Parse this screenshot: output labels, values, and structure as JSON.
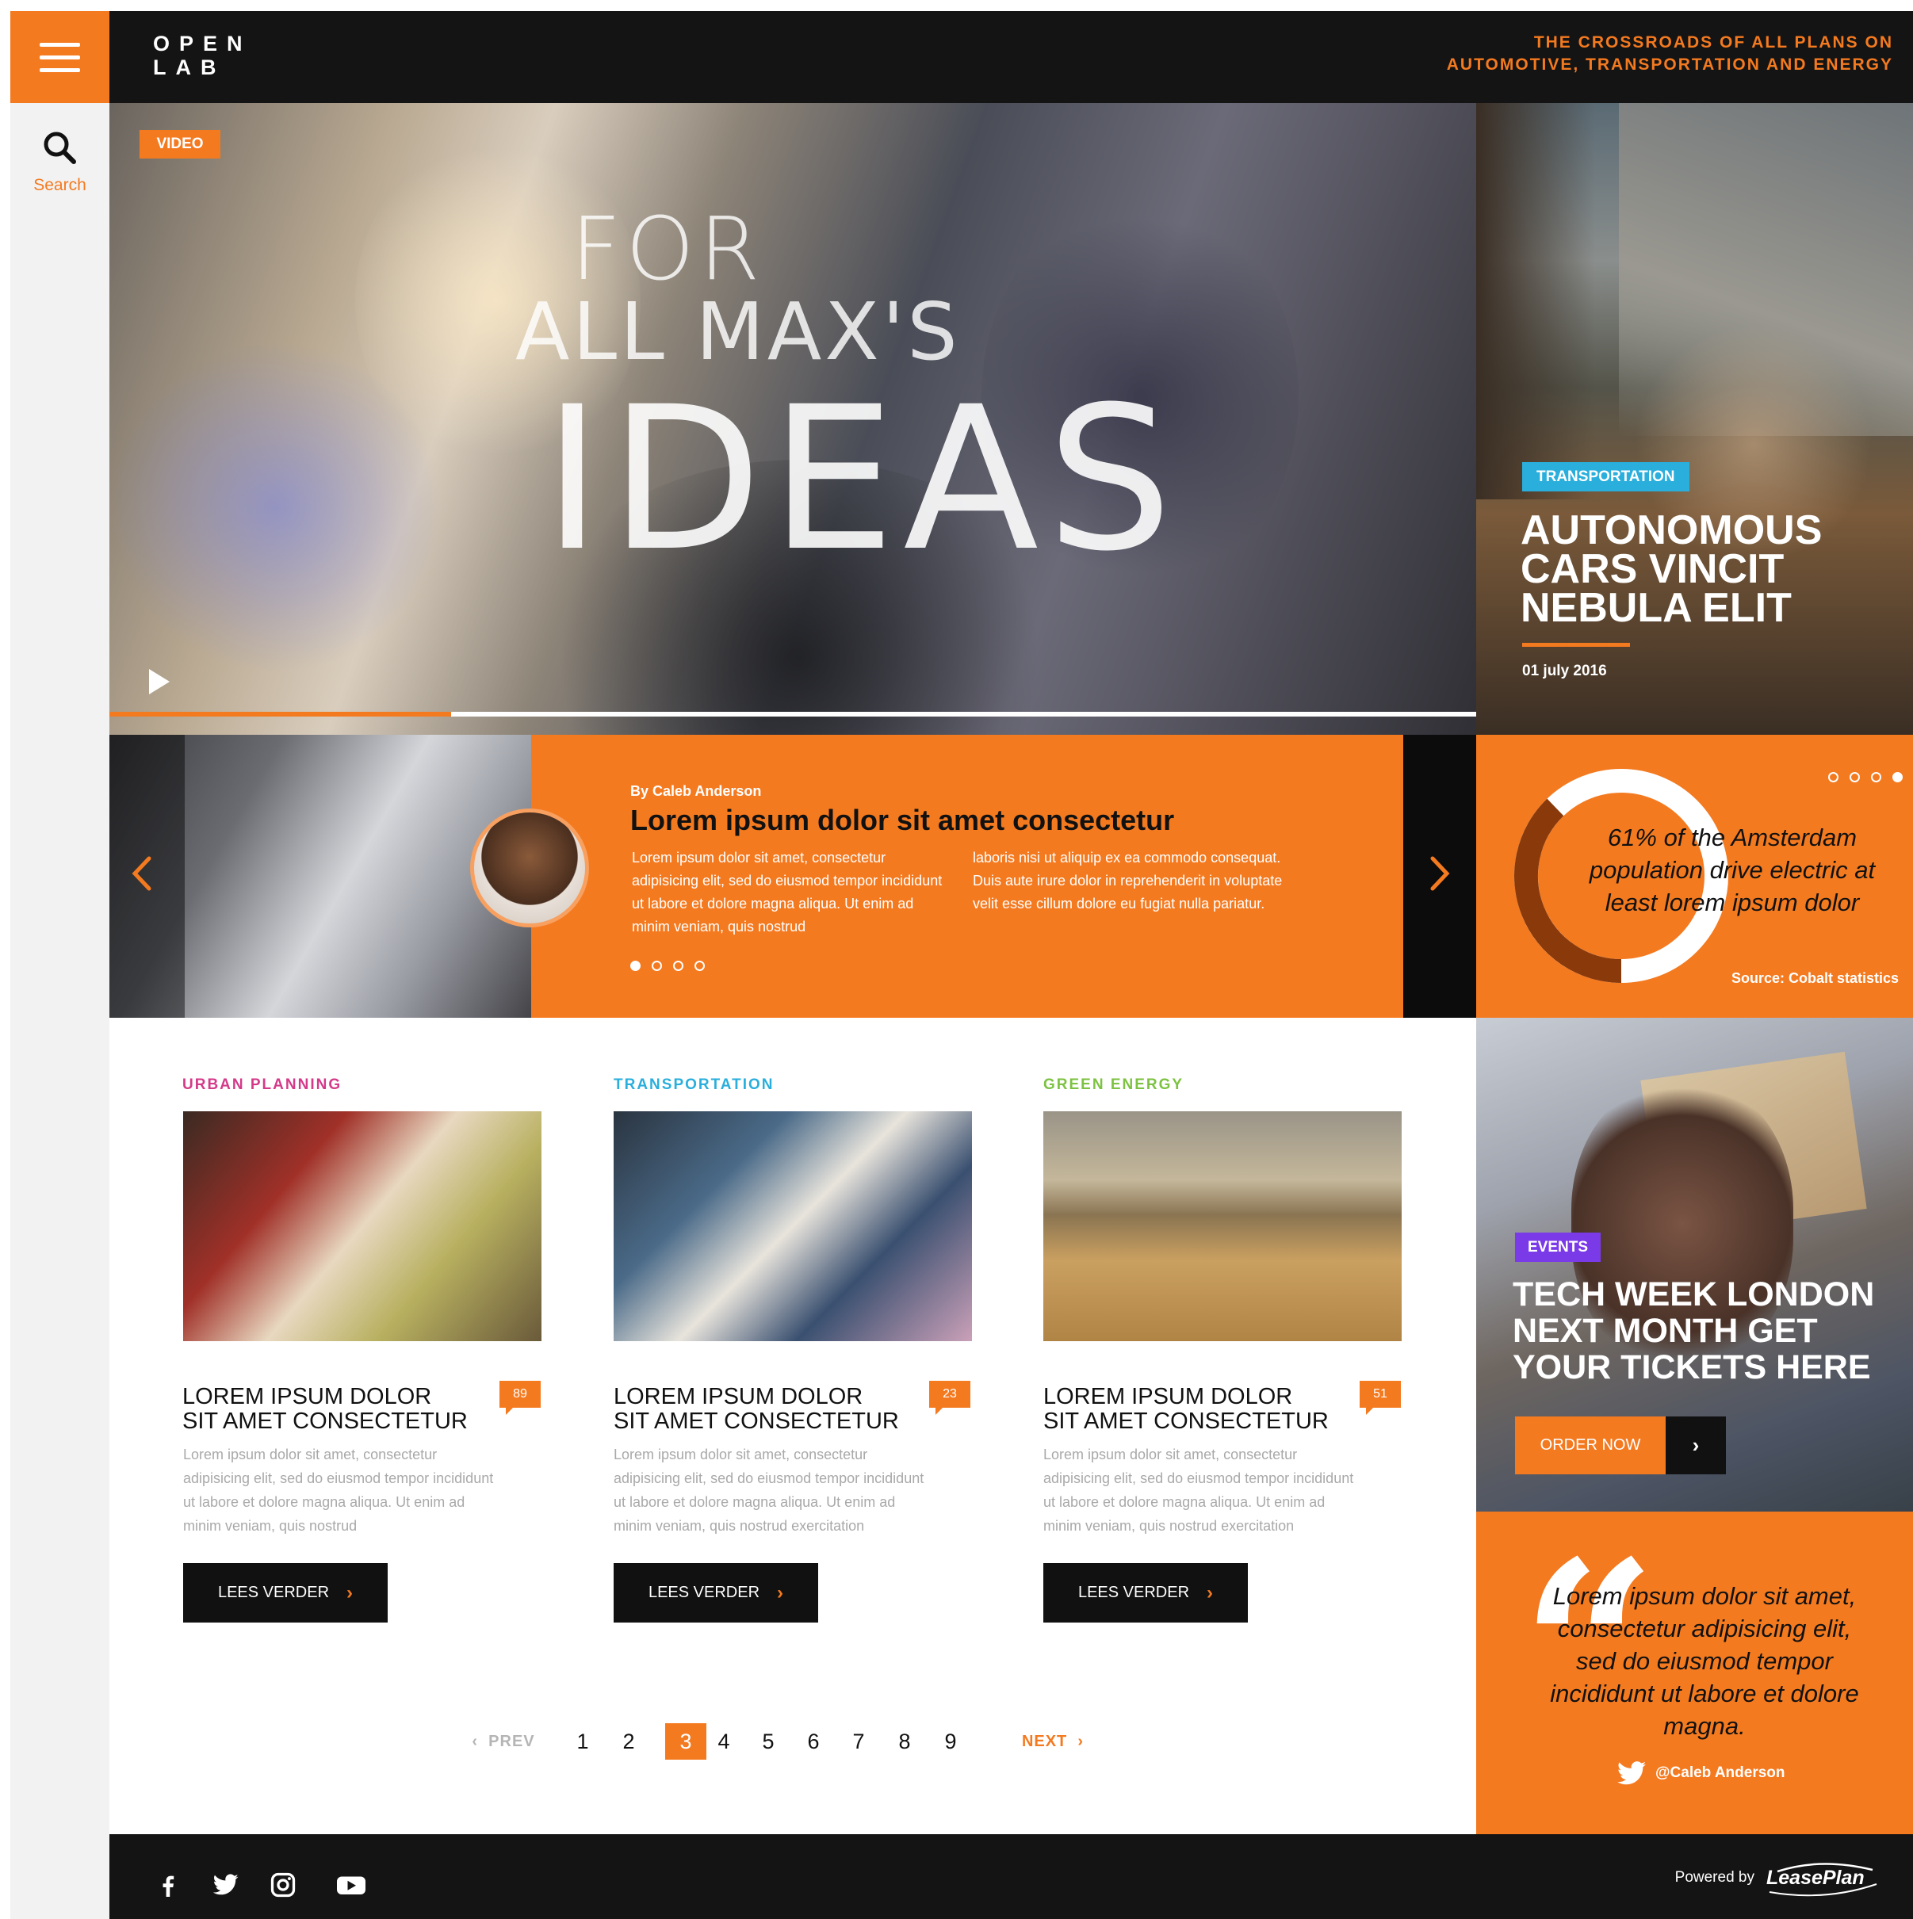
{
  "nav": {
    "search_label": "Search"
  },
  "header": {
    "logo_line1": "OPEN",
    "logo_line2": "LAB",
    "tagline_line1": "THE CROSSROADS OF ALL PLANS ON",
    "tagline_line2": "AUTOMOTIVE, TRANSPORTATION AND ENERGY"
  },
  "hero": {
    "badge": "VIDEO",
    "title_line1": "FOR",
    "title_line2": "ALL MAX'S",
    "title_line3": "IDEAS",
    "progress_fraction": 0.25
  },
  "feature": {
    "tag": "TRANSPORTATION",
    "title_line1": "AUTONOMOUS",
    "title_line2": "CARS VINCIT",
    "title_line3": "NEBULA ELIT",
    "date": "01 july 2016"
  },
  "author_slider": {
    "byline": "By Caleb Anderson",
    "title": "Lorem ipsum dolor sit amet consectetur",
    "col1": "Lorem ipsum dolor sit amet, consectetur adipisicing elit, sed do eiusmod tempor incididunt ut labore et dolore magna aliqua. Ut enim ad minim veniam, quis nostrud",
    "col2": "laboris nisi ut aliquip ex ea commodo consequat. Duis aute irure dolor in reprehenderit in voluptate velit esse cillum dolore eu fugiat nulla pariatur.",
    "slide_count": 4,
    "active_slide": 0
  },
  "stat": {
    "text": "61% of the Amsterdam population drive electric at least lorem ipsum dolor",
    "source": "Source: Cobalt statistics",
    "percent": 61,
    "dot_count": 4,
    "active_dot": 3
  },
  "articles": [
    {
      "category": "URBAN PLANNING",
      "category_color": "#d43a8a",
      "title_line1": "LOREM IPSUM DOLOR",
      "title_line2": "SIT AMET CONSECTETUR",
      "comments": "89",
      "body": "Lorem ipsum dolor sit amet, consectetur adipisicing elit, sed do eiusmod tempor incididunt ut labore et dolore magna aliqua. Ut enim ad minim veniam, quis nostrud",
      "button": "LEES VERDER"
    },
    {
      "category": "TRANSPORTATION",
      "category_color": "#2aaedc",
      "title_line1": "LOREM IPSUM DOLOR",
      "title_line2": "SIT AMET CONSECTETUR",
      "comments": "23",
      "body": "Lorem ipsum dolor sit amet, consectetur adipisicing elit, sed do eiusmod tempor incididunt ut labore et dolore magna aliqua. Ut enim ad minim veniam, quis nostrud exercitation",
      "button": "LEES VERDER"
    },
    {
      "category": "GREEN ENERGY",
      "category_color": "#7dc242",
      "title_line1": "LOREM IPSUM DOLOR",
      "title_line2": "SIT AMET CONSECTETUR",
      "comments": "51",
      "body": "Lorem ipsum dolor sit amet, consectetur adipisicing elit, sed do eiusmod tempor incididunt ut labore et dolore magna aliqua. Ut enim ad minim veniam, quis nostrud exercitation",
      "button": "LEES VERDER"
    }
  ],
  "pagination": {
    "prev": "PREV",
    "next": "NEXT",
    "pages": [
      "1",
      "2",
      "3",
      "4",
      "5",
      "6",
      "7",
      "8",
      "9"
    ],
    "current": "3"
  },
  "events": {
    "tag": "EVENTS",
    "title_line1": "TECH WEEK LONDON",
    "title_line2": "NEXT MONTH GET",
    "title_line3": "YOUR TICKETS HERE",
    "button": "ORDER NOW"
  },
  "quote": {
    "mark": "“",
    "text": "Lorem ipsum dolor sit amet, consectetur adipisicing elit, sed do eiusmod tempor incididunt ut labore et dolore magna.",
    "author": "@Caleb Anderson"
  },
  "footer": {
    "powered_by": "Powered by",
    "brand": "LeasePlan"
  },
  "colors": {
    "accent": "#f47a20",
    "dark": "#141414",
    "transport_blue": "#2aaedc",
    "events_purple": "#7a3ae8"
  },
  "icons": {
    "menu": "hamburger-icon",
    "search": "search-icon",
    "play": "play-icon",
    "prev": "chevron-left-icon",
    "next": "chevron-right-icon",
    "twitter": "twitter-icon",
    "facebook": "facebook-icon",
    "instagram": "instagram-icon",
    "youtube": "youtube-icon"
  }
}
